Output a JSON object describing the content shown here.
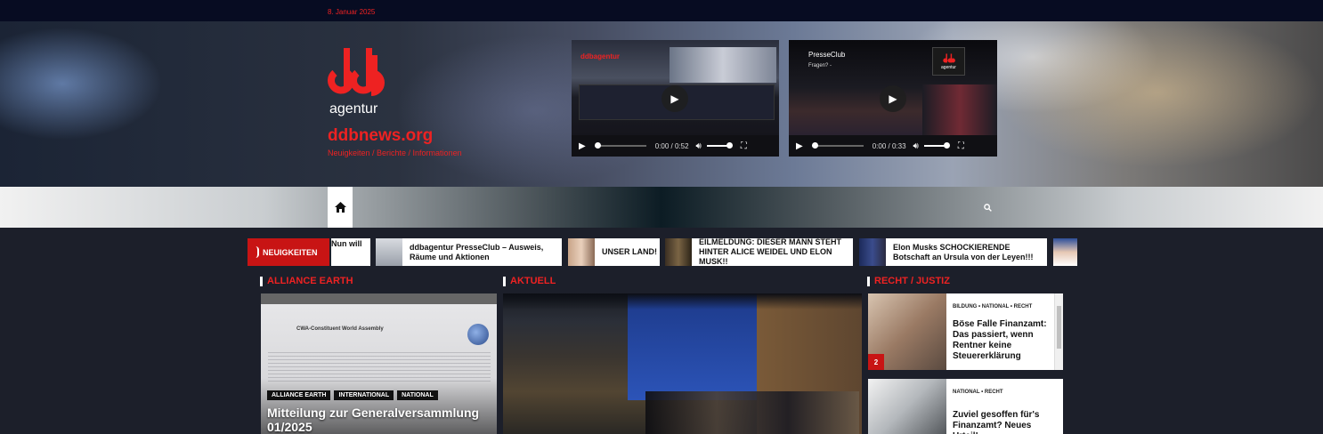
{
  "topbar": {
    "date": "8. Januar 2025"
  },
  "header": {
    "logo_text": "agentur",
    "site_name": "ddbnews.org",
    "tagline": "Neuigkeiten / Berichte / Informationen"
  },
  "videos": [
    {
      "time": "0:00 / 0:52",
      "heading": "ddbagentur"
    },
    {
      "time": "0:00 / 0:33",
      "heading": "PresseClub",
      "subline": "Fragen? -",
      "badge": "agentur"
    }
  ],
  "nav": {
    "home_icon": "home-icon",
    "search_icon": "search-icon"
  },
  "ticker": {
    "label": "NEUIGKEITEN",
    "items": [
      {
        "text": "Nun will"
      },
      {
        "text": "ddbagentur PresseClub – Ausweis, Räume und Aktionen"
      },
      {
        "text": "UNSER LAND!"
      },
      {
        "text": "EILMELDUNG: DIESER MANN STEHT HINTER ALICE WEIDEL UND ELON MUSK!!"
      },
      {
        "text": "Elon Musks SCHOCKIERENDE Botschaft an Ursula von der Leyen!!!"
      }
    ]
  },
  "sections": {
    "col1_title": "ALLIANCE EARTH",
    "col2_title": "AKTUELL",
    "col3_title": "RECHT / JUSTIZ"
  },
  "col1": {
    "doc_heading": "CWA-Constituent World Assembly",
    "badges": [
      "ALLIANCE EARTH",
      "INTERNATIONAL",
      "NATIONAL"
    ],
    "headline": "Mitteilung zur Generalversammlung 01/2025"
  },
  "side": [
    {
      "num": "2",
      "cats": "BILDUNG • NATIONAL • RECHT",
      "title": "Böse Falle Finanzamt: Das passiert, wenn Rentner keine Steuererklärung"
    },
    {
      "cats": "NATIONAL • RECHT",
      "title": "Zuviel gesoffen für's Finanzamt? Neues Urteil!"
    }
  ],
  "colors": {
    "accent": "#e22222",
    "topbar": "#070c22",
    "badge": "#111111"
  }
}
